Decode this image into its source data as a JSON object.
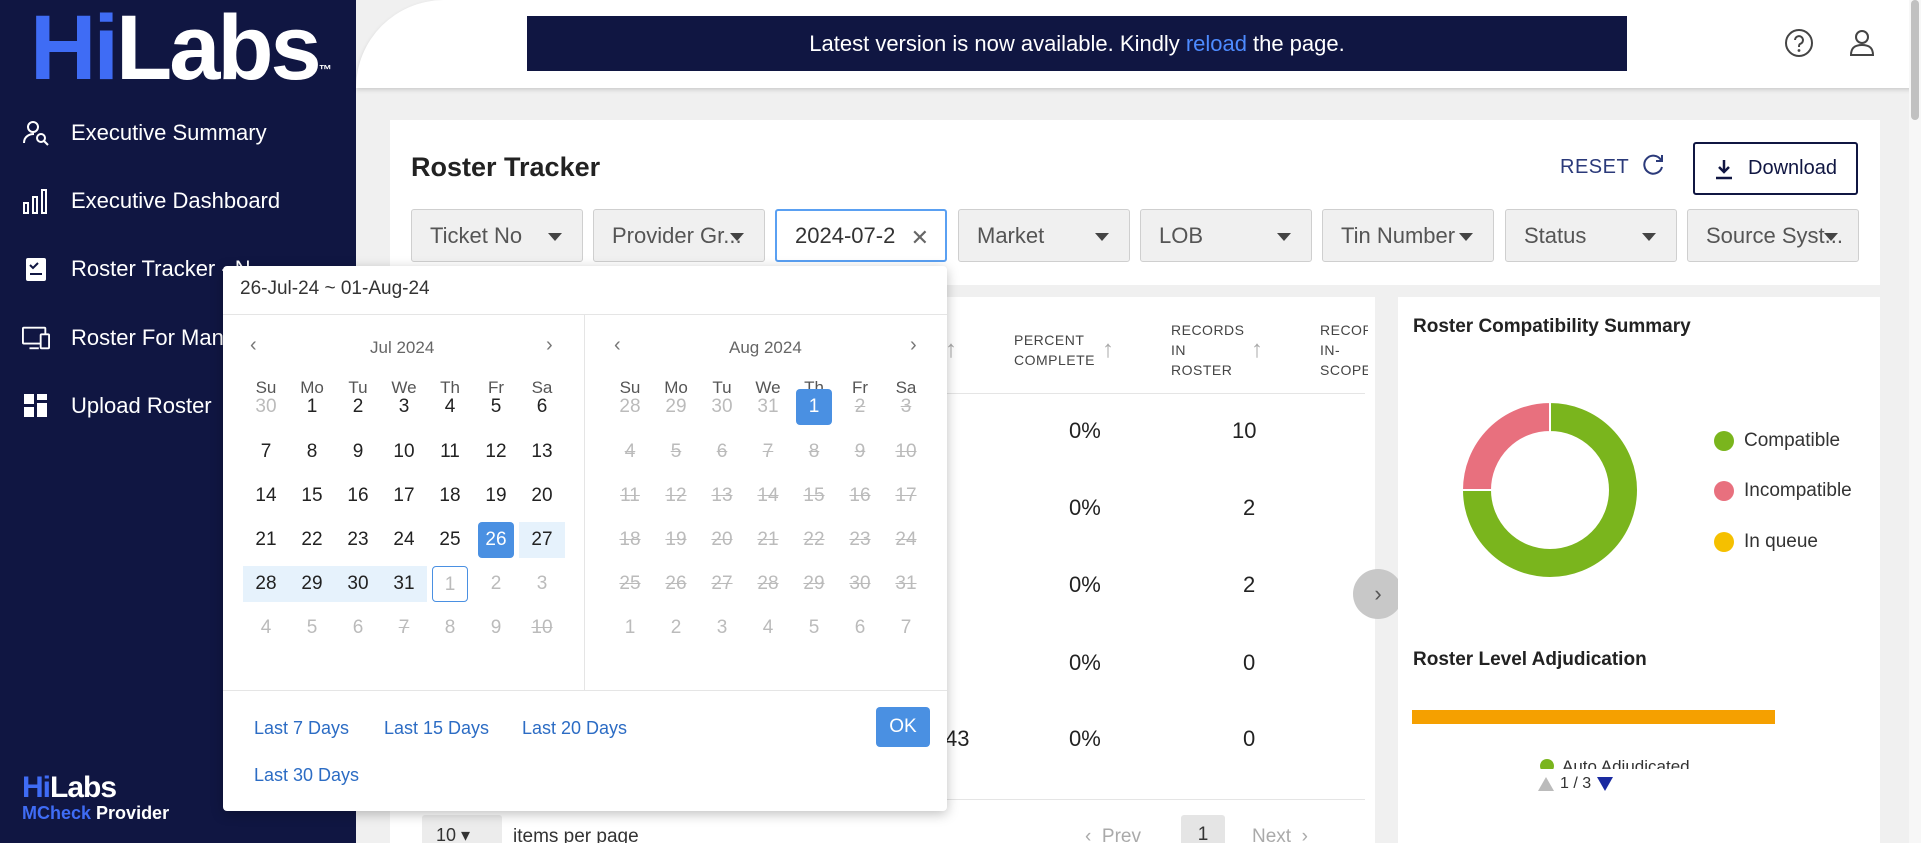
{
  "brand": {
    "logo_hi": "Hi",
    "logo_labs": "Labs",
    "logo_tm": "™",
    "bottom_hi": "Hi",
    "bottom_labs": "Labs",
    "bottom_mcheck": "MCheck",
    "bottom_provider": "Provider"
  },
  "sidebar": {
    "items": [
      {
        "label": "Executive Summary",
        "icon": "user-search-icon"
      },
      {
        "label": "Executive Dashboard",
        "icon": "bar-chart-icon"
      },
      {
        "label": "Roster Tracker - N",
        "icon": "clipboard-check-icon"
      },
      {
        "label": "Roster For Man",
        "icon": "monitor-icon"
      },
      {
        "label": "Upload Roster",
        "icon": "grid-icon"
      }
    ]
  },
  "banner": {
    "prefix": "Latest version is now available. Kindly",
    "link": "reload",
    "suffix": "the page."
  },
  "page": {
    "title": "Roster Tracker",
    "reset": "RESET",
    "download": "Download"
  },
  "filters": [
    {
      "label": "Ticket No"
    },
    {
      "label": "Provider Gr..."
    },
    {
      "label": "2024-07-2"
    },
    {
      "label": "Market"
    },
    {
      "label": "LOB"
    },
    {
      "label": "Tin Number"
    },
    {
      "label": "Status"
    },
    {
      "label": "Source Syst..."
    }
  ],
  "table": {
    "headers": {
      "percent_l1": "PERCENT",
      "percent_l2": "COMPLETE",
      "rec_l1": "RECORDS",
      "rec_l2": "IN",
      "rec_l3": "ROSTER",
      "scope_l1": "RECOR",
      "scope_l2": "IN-",
      "scope_l3": "SCOPE"
    },
    "rows": [
      {
        "percent": "0%",
        "records": "10",
        "extra": ""
      },
      {
        "percent": "0%",
        "records": "2",
        "extra": ""
      },
      {
        "percent": "0%",
        "records": "2",
        "extra": ""
      },
      {
        "percent": "0%",
        "records": "0",
        "extra": ""
      },
      {
        "percent": "0%",
        "records": "0",
        "extra": "43"
      }
    ],
    "items_per_page": "10",
    "items_per_page_label": "items per page",
    "prev": "Prev",
    "page": "1",
    "next": "Next"
  },
  "right_panel": {
    "compat_title": "Roster Compatibility Summary",
    "adjud_title": "Roster Level Adjudication",
    "legend": [
      {
        "label": "Compatible",
        "color": "#7ab51d"
      },
      {
        "label": "Incompatible",
        "color": "#e8707e"
      },
      {
        "label": "In queue",
        "color": "#f5c000"
      }
    ],
    "bar_legend": "Auto Adjudicated",
    "pager": "1 / 3"
  },
  "chart_data": [
    {
      "type": "pie",
      "title": "Roster Compatibility Summary",
      "labels": [
        "Compatible",
        "Incompatible",
        "In queue"
      ],
      "values": [
        75,
        25,
        0
      ],
      "colors": [
        "#7ab51d",
        "#e8707e",
        "#f5c000"
      ]
    },
    {
      "type": "bar",
      "title": "Roster Level Adjudication",
      "categories": [
        "Auto Adjudicated"
      ],
      "values": [
        100
      ],
      "colors": [
        "#f5a000"
      ]
    }
  ],
  "datepicker": {
    "range": "26-Jul-24 ~ 01-Aug-24",
    "left_month": "Jul 2024",
    "right_month": "Aug 2024",
    "weekdays": [
      "Su",
      "Mo",
      "Tu",
      "We",
      "Th",
      "Fr",
      "Sa"
    ],
    "quick": [
      "Last 7 Days",
      "Last 15 Days",
      "Last 20 Days",
      "Last 30 Days"
    ],
    "ok": "OK",
    "left_days": [
      [
        "30",
        "1",
        "2",
        "3",
        "4",
        "5",
        "6"
      ],
      [
        "7",
        "8",
        "9",
        "10",
        "11",
        "12",
        "13"
      ],
      [
        "14",
        "15",
        "16",
        "17",
        "18",
        "19",
        "20"
      ],
      [
        "21",
        "22",
        "23",
        "24",
        "25",
        "26",
        "27"
      ],
      [
        "28",
        "29",
        "30",
        "31",
        "1",
        "2",
        "3"
      ],
      [
        "4",
        "5",
        "6",
        "7",
        "8",
        "9",
        "10"
      ]
    ],
    "right_days": [
      [
        "28",
        "29",
        "30",
        "31",
        "1",
        "2",
        "3"
      ],
      [
        "4",
        "5",
        "6",
        "7",
        "8",
        "9",
        "10"
      ],
      [
        "11",
        "12",
        "13",
        "14",
        "15",
        "16",
        "17"
      ],
      [
        "18",
        "19",
        "20",
        "21",
        "22",
        "23",
        "24"
      ],
      [
        "25",
        "26",
        "27",
        "28",
        "29",
        "30",
        "31"
      ],
      [
        "1",
        "2",
        "3",
        "4",
        "5",
        "6",
        "7"
      ]
    ]
  }
}
